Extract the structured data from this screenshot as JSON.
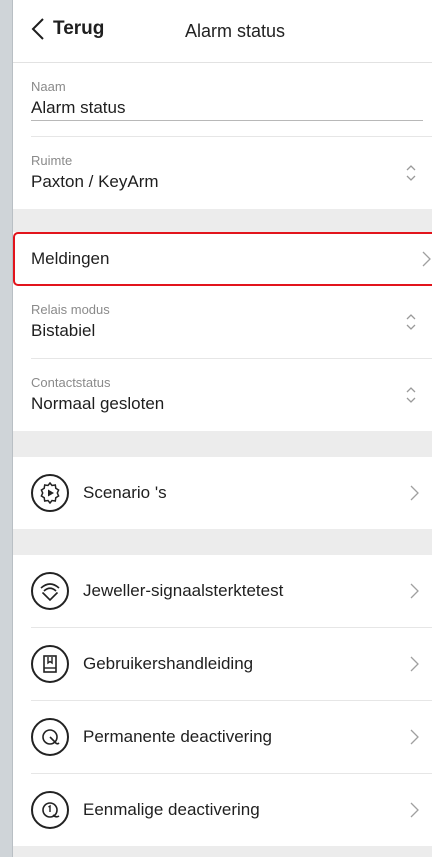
{
  "header": {
    "back_label": "Terug",
    "title": "Alarm status"
  },
  "fields": {
    "naam": {
      "label": "Naam",
      "value": "Alarm status"
    },
    "ruimte": {
      "label": "Ruimte",
      "value": "Paxton / KeyArm"
    },
    "relais": {
      "label": "Relais modus",
      "value": "Bistabiel"
    },
    "contact": {
      "label": "Contactstatus",
      "value": "Normaal gesloten"
    }
  },
  "meldingen": {
    "label": "Meldingen"
  },
  "scenarios": {
    "label": "Scenario 's",
    "icon": "scenario-icon"
  },
  "menu": [
    {
      "label": "Jeweller-signaalsterktetest",
      "icon": "signal-icon"
    },
    {
      "label": "Gebruikershandleiding",
      "icon": "manual-icon"
    },
    {
      "label": "Permanente deactivering",
      "icon": "permanent-deactivation-icon"
    },
    {
      "label": "Eenmalige deactivering",
      "icon": "single-deactivation-icon"
    }
  ],
  "colors": {
    "highlight": "#e2141c",
    "separator": "#ececec"
  }
}
